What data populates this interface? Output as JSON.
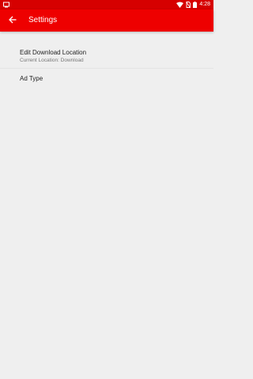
{
  "status_bar": {
    "time": "4:28",
    "icons": [
      "notification-icon",
      "wifi-icon",
      "no-sim-icon",
      "battery-icon"
    ]
  },
  "app_bar": {
    "title": "Settings",
    "back_icon": "arrow-left-icon",
    "color": "#ee0000"
  },
  "preferences": [
    {
      "title": "Edit Download Location",
      "subtitle": "Current Location: Download"
    },
    {
      "title": "Ad Type"
    }
  ]
}
